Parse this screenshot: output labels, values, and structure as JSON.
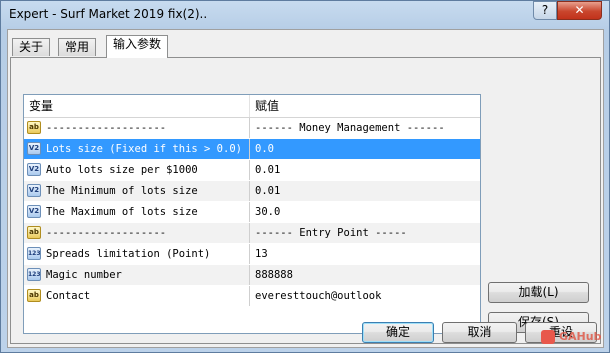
{
  "window": {
    "title": "Expert - Surf Market 2019 fix(2).."
  },
  "titlebar": {
    "help": "?",
    "close": "✕"
  },
  "tabs": [
    {
      "label": "关于"
    },
    {
      "label": "常用"
    },
    {
      "label": "输入参数"
    }
  ],
  "grid": {
    "headers": {
      "variable": "变量",
      "value": "赋值"
    },
    "rows": [
      {
        "icon": "ab-text-icon",
        "icon_text": "ab",
        "name": "-------------------",
        "value": "------ Money Management ------"
      },
      {
        "icon": "double-value-icon",
        "icon_text": "V2",
        "name": "Lots size (Fixed if this > 0.0)",
        "value": "0.0",
        "selected": true
      },
      {
        "icon": "double-value-icon",
        "icon_text": "V2",
        "name": "Auto lots size per $1000",
        "value": "0.01"
      },
      {
        "icon": "double-value-icon",
        "icon_text": "V2",
        "name": "The Minimum of lots size",
        "value": "0.01"
      },
      {
        "icon": "double-value-icon",
        "icon_text": "V2",
        "name": "The Maximum of lots size",
        "value": "30.0"
      },
      {
        "icon": "ab-text-icon",
        "icon_text": "ab",
        "name": "-------------------",
        "value": "------ Entry Point -----"
      },
      {
        "icon": "integer-value-icon",
        "icon_text": "123",
        "name": "Spreads limitation (Point)",
        "value": "13"
      },
      {
        "icon": "integer-value-icon",
        "icon_text": "123",
        "name": "Magic number",
        "value": "888888"
      },
      {
        "icon": "ab-text-icon",
        "icon_text": "ab",
        "name": "Contact",
        "value": "everesttouch@outlook"
      }
    ]
  },
  "side_buttons": {
    "load": "加载(L)",
    "save": "保存(S)"
  },
  "footer_buttons": {
    "ok": "确定",
    "cancel": "取消",
    "reset": "重设"
  },
  "watermark": {
    "text": "GAHub"
  },
  "colors": {
    "selection": "#3399ff",
    "titlebar": "#bcd2ea",
    "close": "#c9462d"
  }
}
